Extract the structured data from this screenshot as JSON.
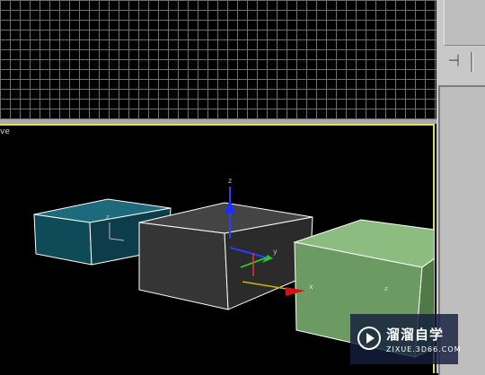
{
  "viewports": {
    "top": {
      "grid": true
    },
    "perspective": {
      "label": "ve",
      "active_border_color": "#e3da72"
    }
  },
  "scene": {
    "objects": [
      {
        "name": "teal-box",
        "color": "#0f4a58"
      },
      {
        "name": "gray-box",
        "color": "#353535"
      },
      {
        "name": "green-box",
        "color": "#6b9a62"
      }
    ],
    "gizmo_axes": {
      "x": "x",
      "y": "y",
      "z": "z"
    }
  },
  "right_panel": {
    "pin_icon": "pin-icon"
  },
  "watermark": {
    "title": "溜溜自学",
    "url": "ZIXUE.3D66.COM"
  }
}
